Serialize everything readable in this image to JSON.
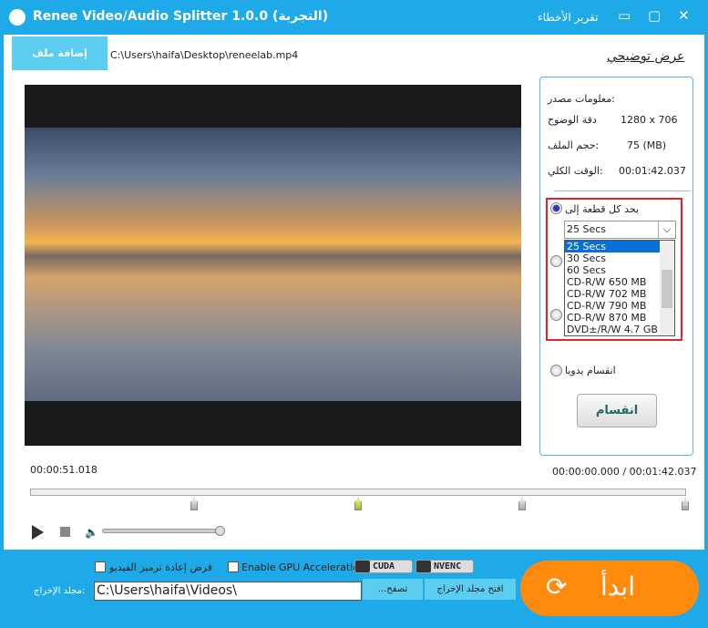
{
  "window": {
    "title": "Renee Video/Audio Splitter 1.0.0 (التجربة)",
    "report_errors": "تقرير الأخطاء",
    "minimize": "▭",
    "restore": "▢",
    "close": "✕"
  },
  "file": {
    "add_button": "إضافة ملف",
    "path": "C:\\Users\\haifa\\Desktop\\reneelab.mp4"
  },
  "preview_label": "عرض توضيحي",
  "source": {
    "heading": "معلومات مصدر:",
    "resolution_label": "دقة الوضوح",
    "resolution": "1280 x 706",
    "size_label": "حجم الملف:",
    "size": "75 (MB)",
    "duration_label": "الوقت الكلي:",
    "duration": "00:01:42.037"
  },
  "split": {
    "each_label": "يحد كل قطعة إلى",
    "selected": "25 Secs",
    "options": [
      "25 Secs",
      "30 Secs",
      "60 Secs",
      "CD-R/W 650 MB",
      "CD-R/W 702 MB",
      "CD-R/W 790 MB",
      "CD-R/W 870 MB",
      "DVD±/R/W 4.7 GB"
    ],
    "manual_label": "انقسام يدويا",
    "split_button": "انقسام"
  },
  "player": {
    "current": "00:00:51.018",
    "range": "00:00:00.000 / 00:01:42.037",
    "volume": 1.0
  },
  "bottom": {
    "reencode_label": "فرض إعادة ترميز الفيديو",
    "gpu_label": "Enable GPU Acceleration",
    "cuda": "CUDA",
    "nvenc": "NVENC",
    "output_label": "مجلد الإخراج:",
    "output_path": "C:\\Users\\haifa\\Videos\\",
    "browse": "...تصفح",
    "open_folder": "افتح مجلد الإخراج",
    "start": "ابدأ"
  },
  "colors": {
    "accent": "#1eaae8",
    "start": "#ff8a0c",
    "highlight": "#e8202e"
  }
}
